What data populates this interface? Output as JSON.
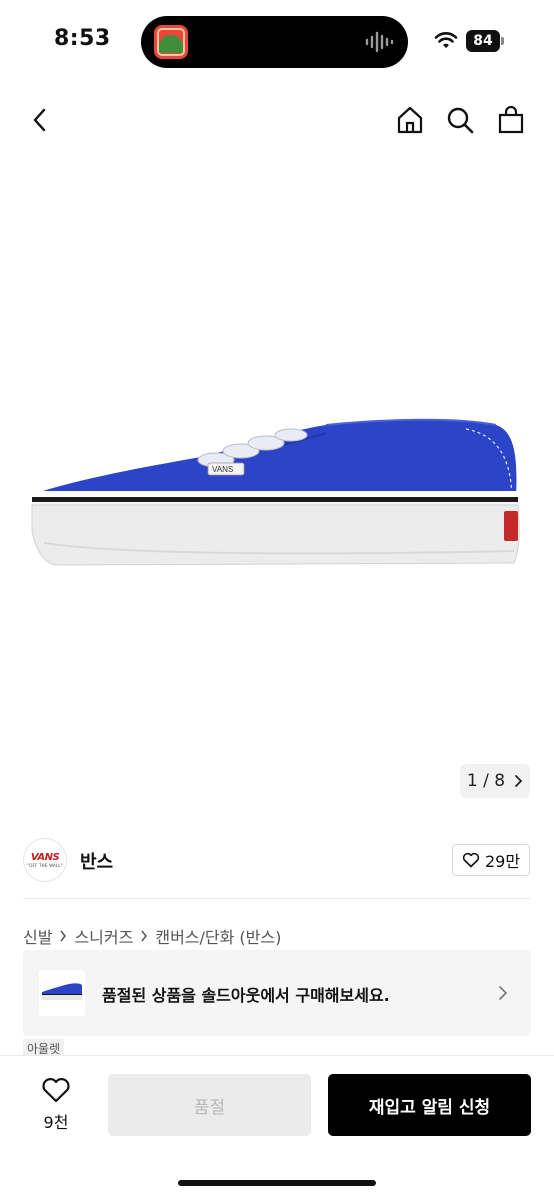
{
  "status_bar": {
    "time": "8:53",
    "battery": "84",
    "icons": [
      "app-icon",
      "sound-wave-icon",
      "wifi-icon",
      "battery-icon"
    ]
  },
  "nav": {
    "icons": [
      "back-chevron-icon",
      "home-icon",
      "search-icon",
      "shopping-bag-icon"
    ]
  },
  "gallery": {
    "current": "1",
    "total": "8",
    "counter": "1 / 8"
  },
  "brand": {
    "name": "반스",
    "logo_text": "VANS",
    "logo_sub": "\"OFF THE WALL\"",
    "likes": "29만"
  },
  "breadcrumb": [
    "신발",
    "스니커즈",
    "캔버스/단화 (반스)"
  ],
  "soldout_banner": {
    "text": "품절된 상품을 솔드아웃에서 구매해보세요."
  },
  "tag": "아울렛",
  "bottom_bar": {
    "like_count": "9천",
    "soldout_label": "품절",
    "restock_label": "재입고 알림 신청"
  },
  "colors": {
    "shoe_blue": "#2c45c8",
    "primary_button": "#000000",
    "disabled_button": "#ebebeb"
  }
}
